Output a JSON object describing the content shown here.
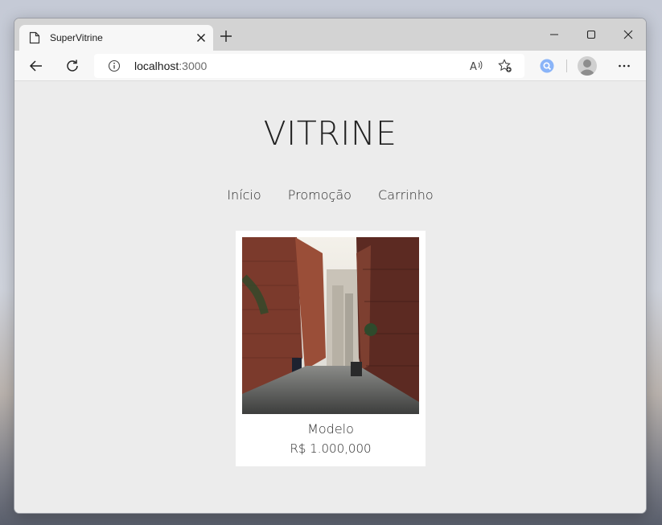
{
  "browser": {
    "tab_title": "SuperVitrine",
    "url_host": "localhost",
    "url_port": ":3000",
    "icons": [
      "page-icon",
      "close-icon",
      "plus-icon",
      "minimize-icon",
      "maximize-icon",
      "window-close-icon",
      "back-icon",
      "refresh-icon",
      "info-icon",
      "read-aloud-icon",
      "favorites-icon",
      "extension-icon",
      "profile-icon",
      "more-icon"
    ]
  },
  "site": {
    "title": "VITRINE",
    "nav": [
      "Início",
      "Promoção",
      "Carrinho"
    ]
  },
  "products": [
    {
      "name": "Modelo",
      "price": "R$ 1.000,000"
    }
  ],
  "colors": {
    "page_bg": "#ececec",
    "card_bg": "#ffffff",
    "text": "#222222"
  }
}
